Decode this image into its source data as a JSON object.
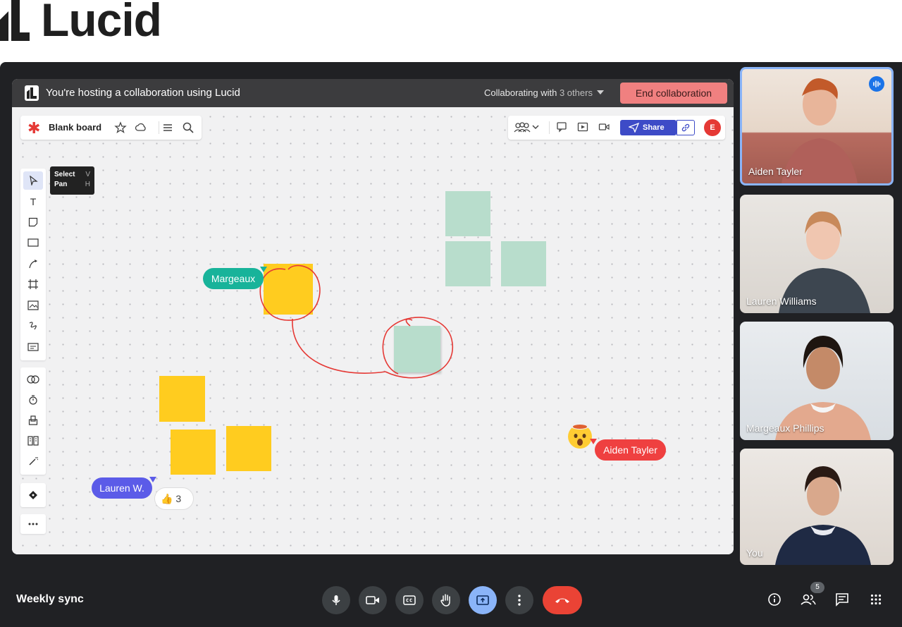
{
  "brand": {
    "name": "Lucid"
  },
  "lucid": {
    "host_banner": "You're hosting a collaboration using Lucid",
    "collab_prefix": "Collaborating with",
    "collab_count": "3 others",
    "end_button": "End collaboration",
    "board_title": "Blank board",
    "share_label": "Share",
    "user_avatar": "E",
    "tooltip": {
      "select": "Select",
      "select_key": "V",
      "pan": "Pan",
      "pan_key": "H"
    },
    "cursors": [
      {
        "name": "Margeaux",
        "color": "#18b39a"
      },
      {
        "name": "Lauren W.",
        "color": "#5b5be8"
      },
      {
        "name": "Aiden Tayler",
        "color": "#ef4040"
      }
    ],
    "reaction": {
      "emoji": "👍",
      "count": "3"
    }
  },
  "participants": [
    {
      "name": "Aiden Tayler",
      "speaking": true
    },
    {
      "name": "Lauren Williams"
    },
    {
      "name": "Margeaux Phillips"
    },
    {
      "name": "You"
    }
  ],
  "meeting": {
    "title": "Weekly sync",
    "people_count": "5"
  },
  "colors": {
    "sticky_yellow": "#ffcc1f",
    "sticky_mint": "#b8ddcc",
    "hangup": "#ea4335",
    "share_accent": "#8ab4f8"
  }
}
